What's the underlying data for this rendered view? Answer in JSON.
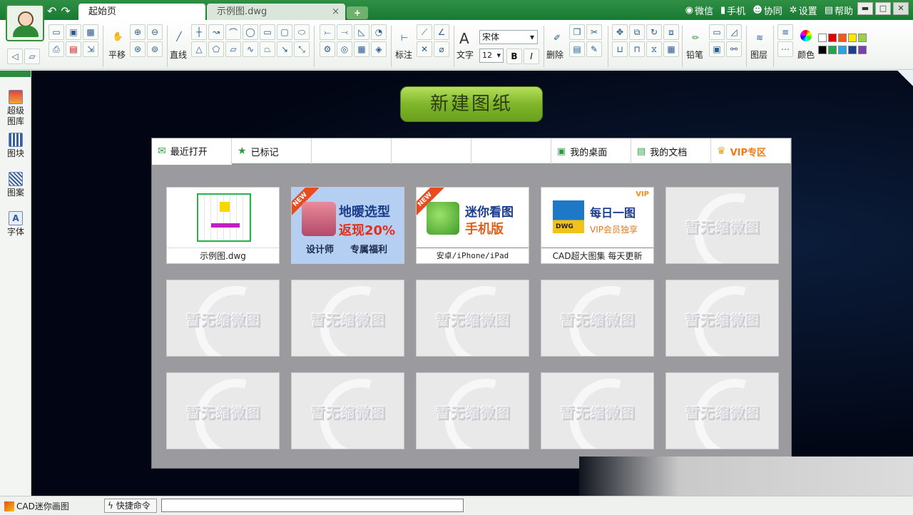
{
  "titlebar": {
    "tabs": [
      {
        "label": "起始页",
        "active": true
      },
      {
        "label": "示例图.dwg",
        "close": "×"
      }
    ],
    "add_tab": "+",
    "links": [
      {
        "label": "微信",
        "icon": "wechat-icon"
      },
      {
        "label": "手机",
        "icon": "phone-icon"
      },
      {
        "label": "协同",
        "icon": "people-icon"
      },
      {
        "label": "设置",
        "icon": "gear-icon"
      },
      {
        "label": "帮助",
        "icon": "help-icon"
      }
    ],
    "win": {
      "min": "▬",
      "max": "□",
      "close": "✕"
    }
  },
  "toolbar": {
    "pan": "平移",
    "line": "直线",
    "dimension": "标注",
    "text": "文字",
    "font": "宋体",
    "font_size": "12",
    "bold": "B",
    "italic": "I",
    "delete": "删除",
    "pencil": "铅笔",
    "layers": "图层",
    "color": "颜色",
    "swatches_row1": [
      "#ffffff",
      "#e00000",
      "#f25a1a",
      "#ffe800",
      "#9bd14a"
    ],
    "swatches_row2": [
      "#000000",
      "#1fa84a",
      "#26a6e6",
      "#1c3f8f",
      "#7c3fb0"
    ]
  },
  "leftpanel": {
    "items": [
      {
        "label": "超级\n图库",
        "l1": "超级",
        "l2": "图库"
      },
      {
        "label": "图块"
      },
      {
        "label": "图案"
      },
      {
        "label": "字体"
      }
    ]
  },
  "main": {
    "new_button": "新建图纸",
    "tabs": [
      {
        "label": "最近打开",
        "icon": "mail-icon"
      },
      {
        "label": "已标记",
        "icon": "star-icon"
      },
      {
        "label": ""
      },
      {
        "label": ""
      },
      {
        "label": ""
      },
      {
        "label": "我的桌面",
        "icon": "desktop-icon"
      },
      {
        "label": "我的文档",
        "icon": "document-icon"
      },
      {
        "label": "VIP专区",
        "icon": "vip-icon"
      }
    ],
    "cards": {
      "sample": "示例图.dwg",
      "floor_heating": {
        "title": "地暖选型",
        "promo": "返现20%",
        "sub1": "设计师",
        "sub2": "专属福利",
        "badge": "NEW"
      },
      "mini_view": {
        "title": "迷你看图",
        "sub": "手机版",
        "caption": "安卓/iPhone/iPad",
        "badge": "NEW"
      },
      "daily": {
        "title": "每日一图",
        "vip": "VIP会员独享",
        "caption": "CAD超大图集 每天更新",
        "dwg": "DWG",
        "vipmark": "VIP"
      },
      "placeholder": "暂无缩微图"
    }
  },
  "status": {
    "app_name": "CAD迷你画图",
    "quick_cmd": "快捷命令"
  }
}
